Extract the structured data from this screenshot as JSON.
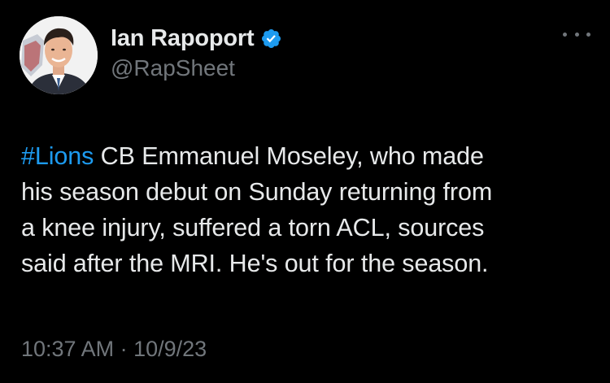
{
  "author": {
    "display_name": "Ian Rapoport",
    "handle": "@RapSheet",
    "verified": true,
    "avatar_icon": "profile-photo"
  },
  "tweet": {
    "hashtag": "#Lions",
    "line1_rest": " CB Emmanuel Moseley, who made",
    "line2": "his season debut on Sunday returning from",
    "line3": "a knee injury, suffered a torn ACL, sources",
    "line4": "said after the MRI. He's out for the season.",
    "time": "10:37 AM",
    "separator": " · ",
    "date": "10/9/23"
  },
  "colors": {
    "background": "#000000",
    "text": "#e7e9ea",
    "muted": "#71767b",
    "accent": "#1d9bf0"
  },
  "icons": {
    "verified": "verified-badge-icon",
    "more": "more-options-icon"
  }
}
